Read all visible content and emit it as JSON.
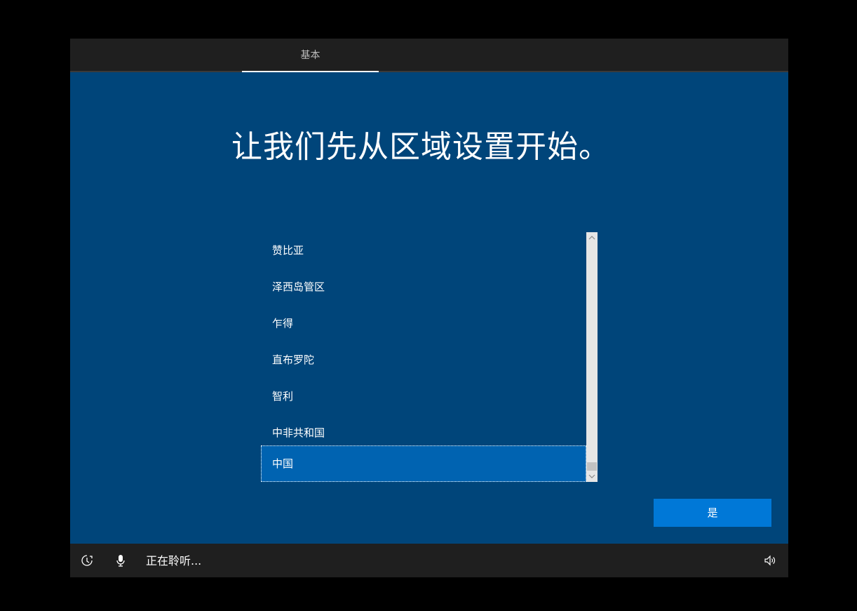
{
  "header": {
    "tab_label": "基本"
  },
  "main": {
    "title": "让我们先从区域设置开始。",
    "regions": [
      {
        "label": "赞比亚",
        "selected": false
      },
      {
        "label": "泽西岛管区",
        "selected": false
      },
      {
        "label": "乍得",
        "selected": false
      },
      {
        "label": "直布罗陀",
        "selected": false
      },
      {
        "label": "智利",
        "selected": false
      },
      {
        "label": "中非共和国",
        "selected": false
      },
      {
        "label": "中国",
        "selected": true
      }
    ],
    "yes_label": "是"
  },
  "footer": {
    "accessibility_icon": "ease-of-access-icon",
    "mic_icon": "microphone-icon",
    "status_text": "正在聆听...",
    "volume_icon": "volume-icon"
  },
  "colors": {
    "background": "#00457a",
    "bar": "#1f1f1f",
    "accent": "#0078d7",
    "selected": "#0063b1"
  }
}
